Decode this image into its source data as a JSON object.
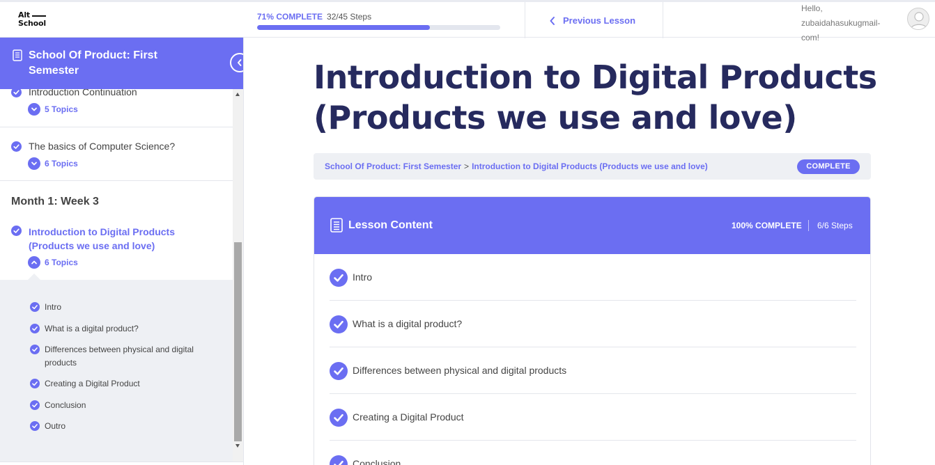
{
  "header": {
    "logo_line1": "Alt",
    "logo_line2": "School",
    "progress_percent_label": "71% COMPLETE",
    "progress_steps_label": "32/45 Steps",
    "progress_fraction": 0.71,
    "previous_lesson_label": "Previous Lesson",
    "greeting_line1": "Hello,",
    "greeting_line2": "zubaidahasukugmail-",
    "greeting_line3": "com!"
  },
  "sidebar": {
    "course_title": "School Of Product: First Semester",
    "items": [
      {
        "name": "Introduction Continuation",
        "topics_label": "5 Topics"
      },
      {
        "name": "The basics of Computer Science?",
        "topics_label": "6 Topics"
      }
    ],
    "week_heading": "Month 1: Week 3",
    "active_lesson": {
      "name": "Introduction to Digital Products (Products we use and love)",
      "topics_label": "6 Topics",
      "topics": [
        "Intro",
        "What is a digital product?",
        "Differences between physical and digital products",
        "Creating a Digital Product",
        "Conclusion",
        "Outro"
      ]
    }
  },
  "main": {
    "title": "Introduction to Digital Products (Products we use and love)",
    "breadcrumb": {
      "course": "School Of Product: First Semester",
      "separator": ">",
      "lesson": "Introduction to Digital Products (Products we use and love)"
    },
    "status_badge": "COMPLETE",
    "lesson_content": {
      "heading": "Lesson Content",
      "percent_label": "100% COMPLETE",
      "steps_label": "6/6 Steps",
      "rows": [
        "Intro",
        "What is a digital product?",
        "Differences between physical and digital products",
        "Creating a Digital Product",
        "Conclusion"
      ]
    }
  },
  "colors": {
    "accent": "#6b6ef2",
    "title_navy": "#262a5e",
    "panel_gray": "#eef0f4"
  },
  "icons": {
    "check": "check-circle-icon",
    "document": "document-icon",
    "chevron_left": "chevron-left-icon",
    "chevron_down": "chevron-down-icon",
    "chevron_up": "chevron-up-icon",
    "avatar": "user-avatar-icon"
  }
}
